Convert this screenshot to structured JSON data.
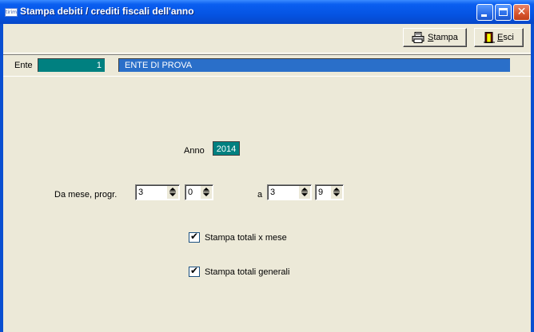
{
  "window": {
    "title": "Stampa debiti / crediti fiscali dell'anno",
    "icon_name": "app-icon",
    "icon_text": "tirim"
  },
  "toolbar": {
    "stampa_label": "Stampa",
    "stampa_mnemonic": "S",
    "stampa_rest": "tampa",
    "esci_label": "Esci",
    "esci_mnemonic": "E",
    "esci_rest": "sci"
  },
  "ente": {
    "label": "Ente",
    "code": "1",
    "name": "ENTE DI PROVA"
  },
  "form": {
    "anno_label": "Anno",
    "anno_value": "2014",
    "da_label": "Da mese, progr.",
    "da_mese": "3",
    "da_progr": "0",
    "a_label": "a",
    "a_mese": "3",
    "a_progr": "9",
    "check_totali_mese_label": "Stampa totali x mese",
    "check_totali_mese_checked": true,
    "check_totali_generali_label": "Stampa totali generali",
    "check_totali_generali_checked": true
  },
  "colors": {
    "titlebar": "#0554e3",
    "field_teal": "#008080",
    "ente_name_bg": "#2a6fc9",
    "face": "#ece9d8"
  }
}
